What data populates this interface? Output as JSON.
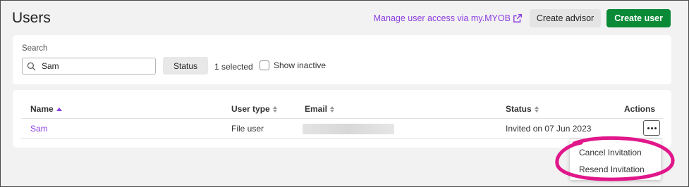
{
  "header": {
    "title": "Users",
    "manage_link": "Manage user access via my.MYOB",
    "create_advisor": "Create advisor",
    "create_user": "Create user"
  },
  "filters": {
    "search_label": "Search",
    "search_value": "Sam",
    "status_button": "Status",
    "selected_count": "1 selected",
    "show_inactive_label": "Show inactive",
    "show_inactive_checked": false
  },
  "table": {
    "columns": [
      {
        "label": "Name",
        "sort": "asc"
      },
      {
        "label": "User type",
        "sort": "none"
      },
      {
        "label": "Email",
        "sort": "none"
      },
      {
        "label": "Status",
        "sort": "none"
      },
      {
        "label": "Actions"
      }
    ],
    "rows": [
      {
        "name": "Sam",
        "user_type": "File user",
        "email": "",
        "status": "Invited on 07 Jun 2023"
      }
    ]
  },
  "actions_menu": {
    "items": [
      "Cancel Invitation",
      "Resend Invitation"
    ]
  },
  "colors": {
    "accent": "#8c3ee0",
    "primary_button": "#0a8a37",
    "highlight": "#e0178a"
  }
}
